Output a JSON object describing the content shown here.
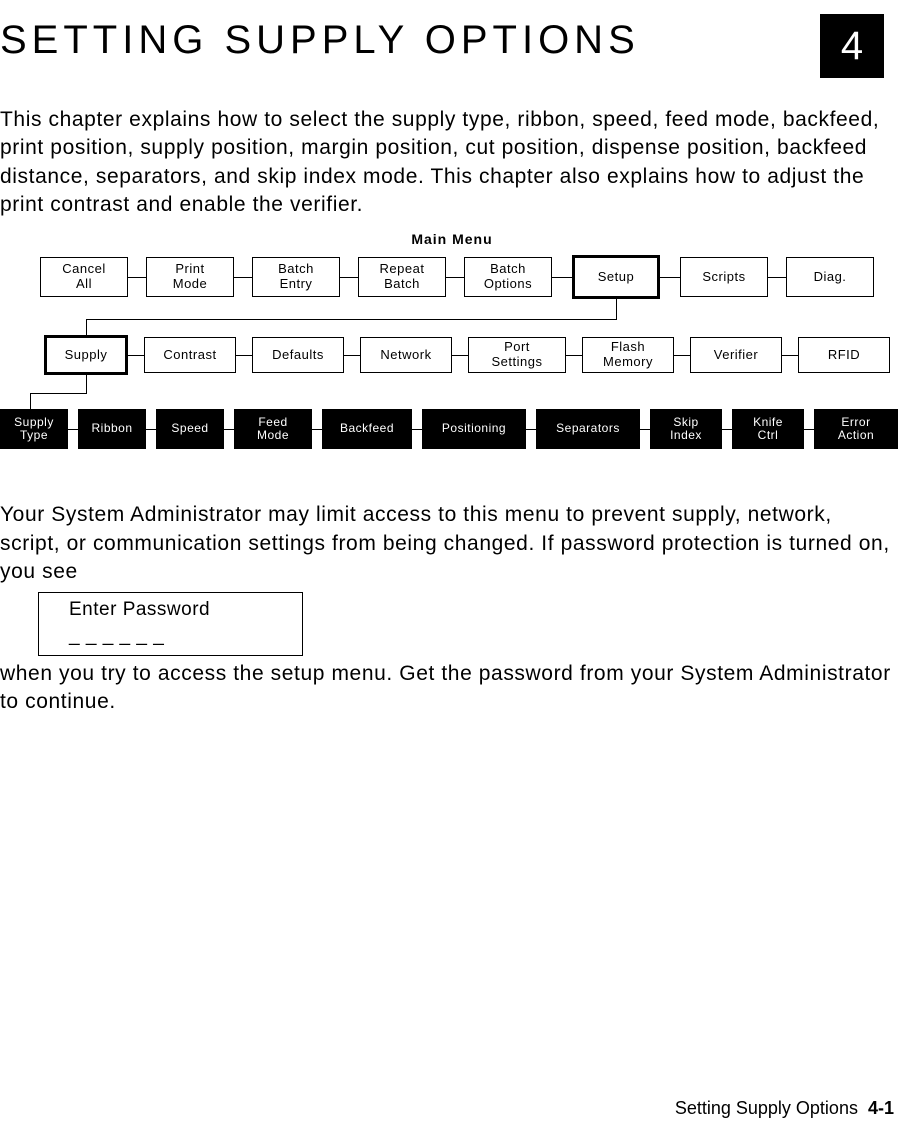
{
  "chapter": {
    "title": "SETTING SUPPLY OPTIONS",
    "number": "4"
  },
  "intro": "This chapter explains how to select the supply type, ribbon, speed, feed mode, backfeed, print position, supply position, margin position, cut position, dispense position, backfeed distance, separators, and skip index mode.  This chapter also explains how to adjust the print contrast and enable the verifier.",
  "menu": {
    "title": "Main Menu",
    "row1": [
      "Cancel\nAll",
      "Print\nMode",
      "Batch\nEntry",
      "Repeat\nBatch",
      "Batch\nOptions",
      "Setup",
      "Scripts",
      "Diag."
    ],
    "row2": [
      "Supply",
      "Contrast",
      "Defaults",
      "Network",
      "Port\nSettings",
      "Flash\nMemory",
      "Verifier",
      "RFID"
    ],
    "row3": [
      "Supply\nType",
      "Ribbon",
      "Speed",
      "Feed\nMode",
      "Backfeed",
      "Positioning",
      "Separators",
      "Skip\nIndex",
      "Knife\nCtrl",
      "Error\nAction"
    ]
  },
  "admin_text": "Your System Administrator may limit access to this menu to prevent supply, network, script, or communication settings from being changed.  If password protection is turned on, you see",
  "password_box": {
    "line1": "Enter Password",
    "line2": "_ _ _ _ _ _"
  },
  "after_text": "when you try to access the setup menu.  Get the password from your System Administrator to continue.",
  "footer": {
    "label": "Setting Supply Options",
    "page": "4-1"
  }
}
